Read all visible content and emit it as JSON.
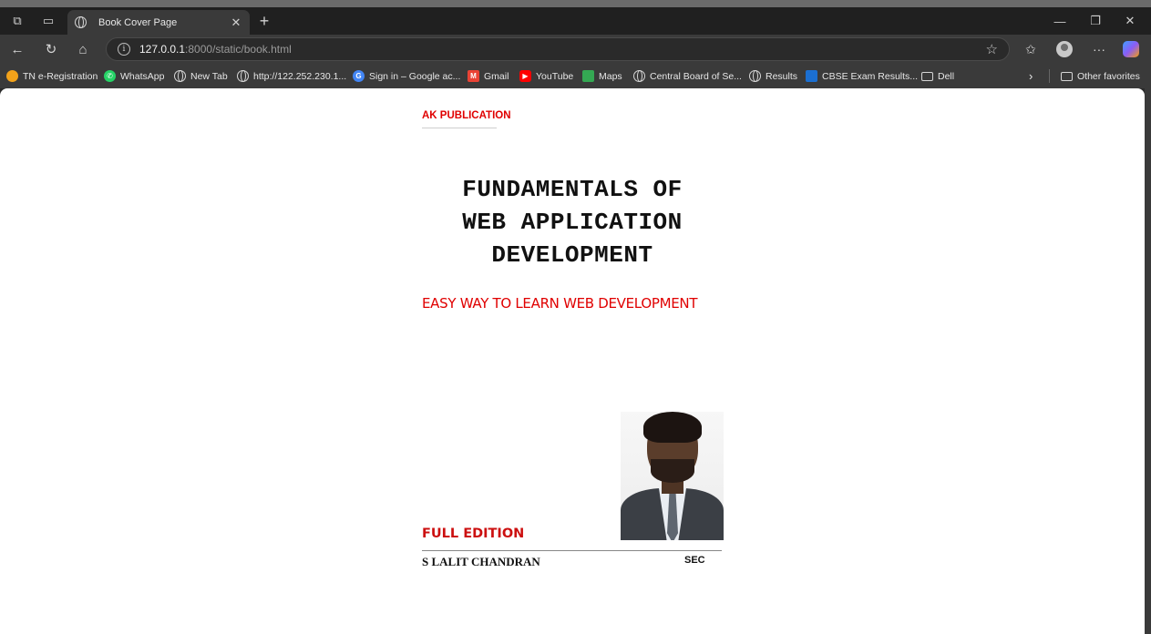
{
  "browser": {
    "tab": {
      "title": "Book Cover Page"
    },
    "address": {
      "host": "127.0.0.1",
      "rest": ":8000/static/book.html"
    },
    "bookmarks": [
      {
        "label": "TN e-Registration",
        "icon": "tn-icon"
      },
      {
        "label": "WhatsApp",
        "icon": "whatsapp-icon"
      },
      {
        "label": "New Tab",
        "icon": "globe-icon"
      },
      {
        "label": "http://122.252.230.1...",
        "icon": "globe-icon"
      },
      {
        "label": "Sign in – Google ac...",
        "icon": "google-icon"
      },
      {
        "label": "Gmail",
        "icon": "gmail-icon"
      },
      {
        "label": "YouTube",
        "icon": "youtube-icon"
      },
      {
        "label": "Maps",
        "icon": "maps-icon"
      },
      {
        "label": "Central Board of Se...",
        "icon": "globe-icon"
      },
      {
        "label": "Results",
        "icon": "globe-icon"
      },
      {
        "label": "CBSE Exam Results...",
        "icon": "cbse-icon"
      },
      {
        "label": "Dell",
        "icon": "folder-icon"
      }
    ],
    "other_favorites": "Other favorites"
  },
  "book": {
    "publisher": "AK PUBLICATION",
    "title_lines": [
      "FUNDAMENTALS OF",
      "WEB APPLICATION",
      "DEVELOPMENT"
    ],
    "subtitle": "EASY WAY TO LEARN WEB DEVELOPMENT",
    "edition": "FULL EDITION",
    "author": "S LALIT CHANDRAN",
    "institution": "SEC"
  },
  "colors": {
    "accent_red": "#e00000",
    "browser_dark": "#202020",
    "browser_toolbar": "#3a3a3a"
  }
}
